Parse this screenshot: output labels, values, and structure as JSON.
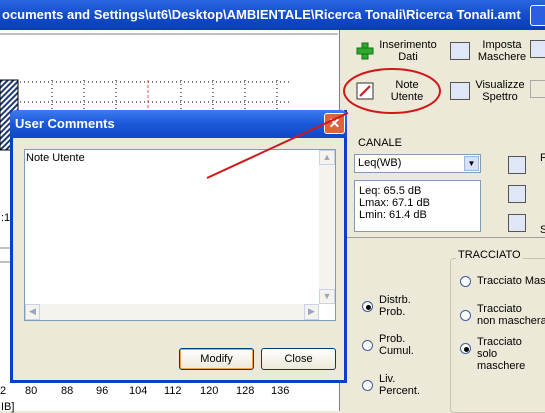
{
  "window": {
    "title": "ocuments and Settings\\ut6\\Desktop\\AMBIENTALE\\Ricerca Tonali\\Ricerca Tonali.amt"
  },
  "chart": {
    "x_ticks": [
      "2",
      "80",
      "88",
      "96",
      "104",
      "112",
      "120",
      "128",
      "136"
    ],
    "bottom_label": "IB]",
    "left_label": ":1"
  },
  "toolbar": {
    "inserimento": "Inserimento\nDati",
    "imposta": "Imposta\nMaschere",
    "note": "Note\nUtente",
    "visualizza": "Visualizzе\nSpettro"
  },
  "canale": {
    "title": "CANALE",
    "select_value": "Leq(WB)",
    "stats": [
      "Leq: 65.5 dB",
      "Lmax: 67.1 dB",
      "Lmin: 61.4 dB"
    ],
    "side_letters": [
      "F",
      "",
      "S"
    ]
  },
  "tracciato": {
    "title": "TRACCIATO",
    "options": [
      "Tracciato Mas",
      "Tracciato\nnon maschera",
      "Tracciato\nsolo maschere"
    ],
    "selected": 2
  },
  "distr": {
    "options": [
      "Distrb.\nProb.",
      "Prob.\nCumul.",
      "Liv.\nPercent."
    ],
    "selected": 0
  },
  "dialog": {
    "title": "User Comments",
    "text": "Note Utente",
    "modify": "Modify",
    "close": "Close",
    "close_glyph": "✕"
  }
}
